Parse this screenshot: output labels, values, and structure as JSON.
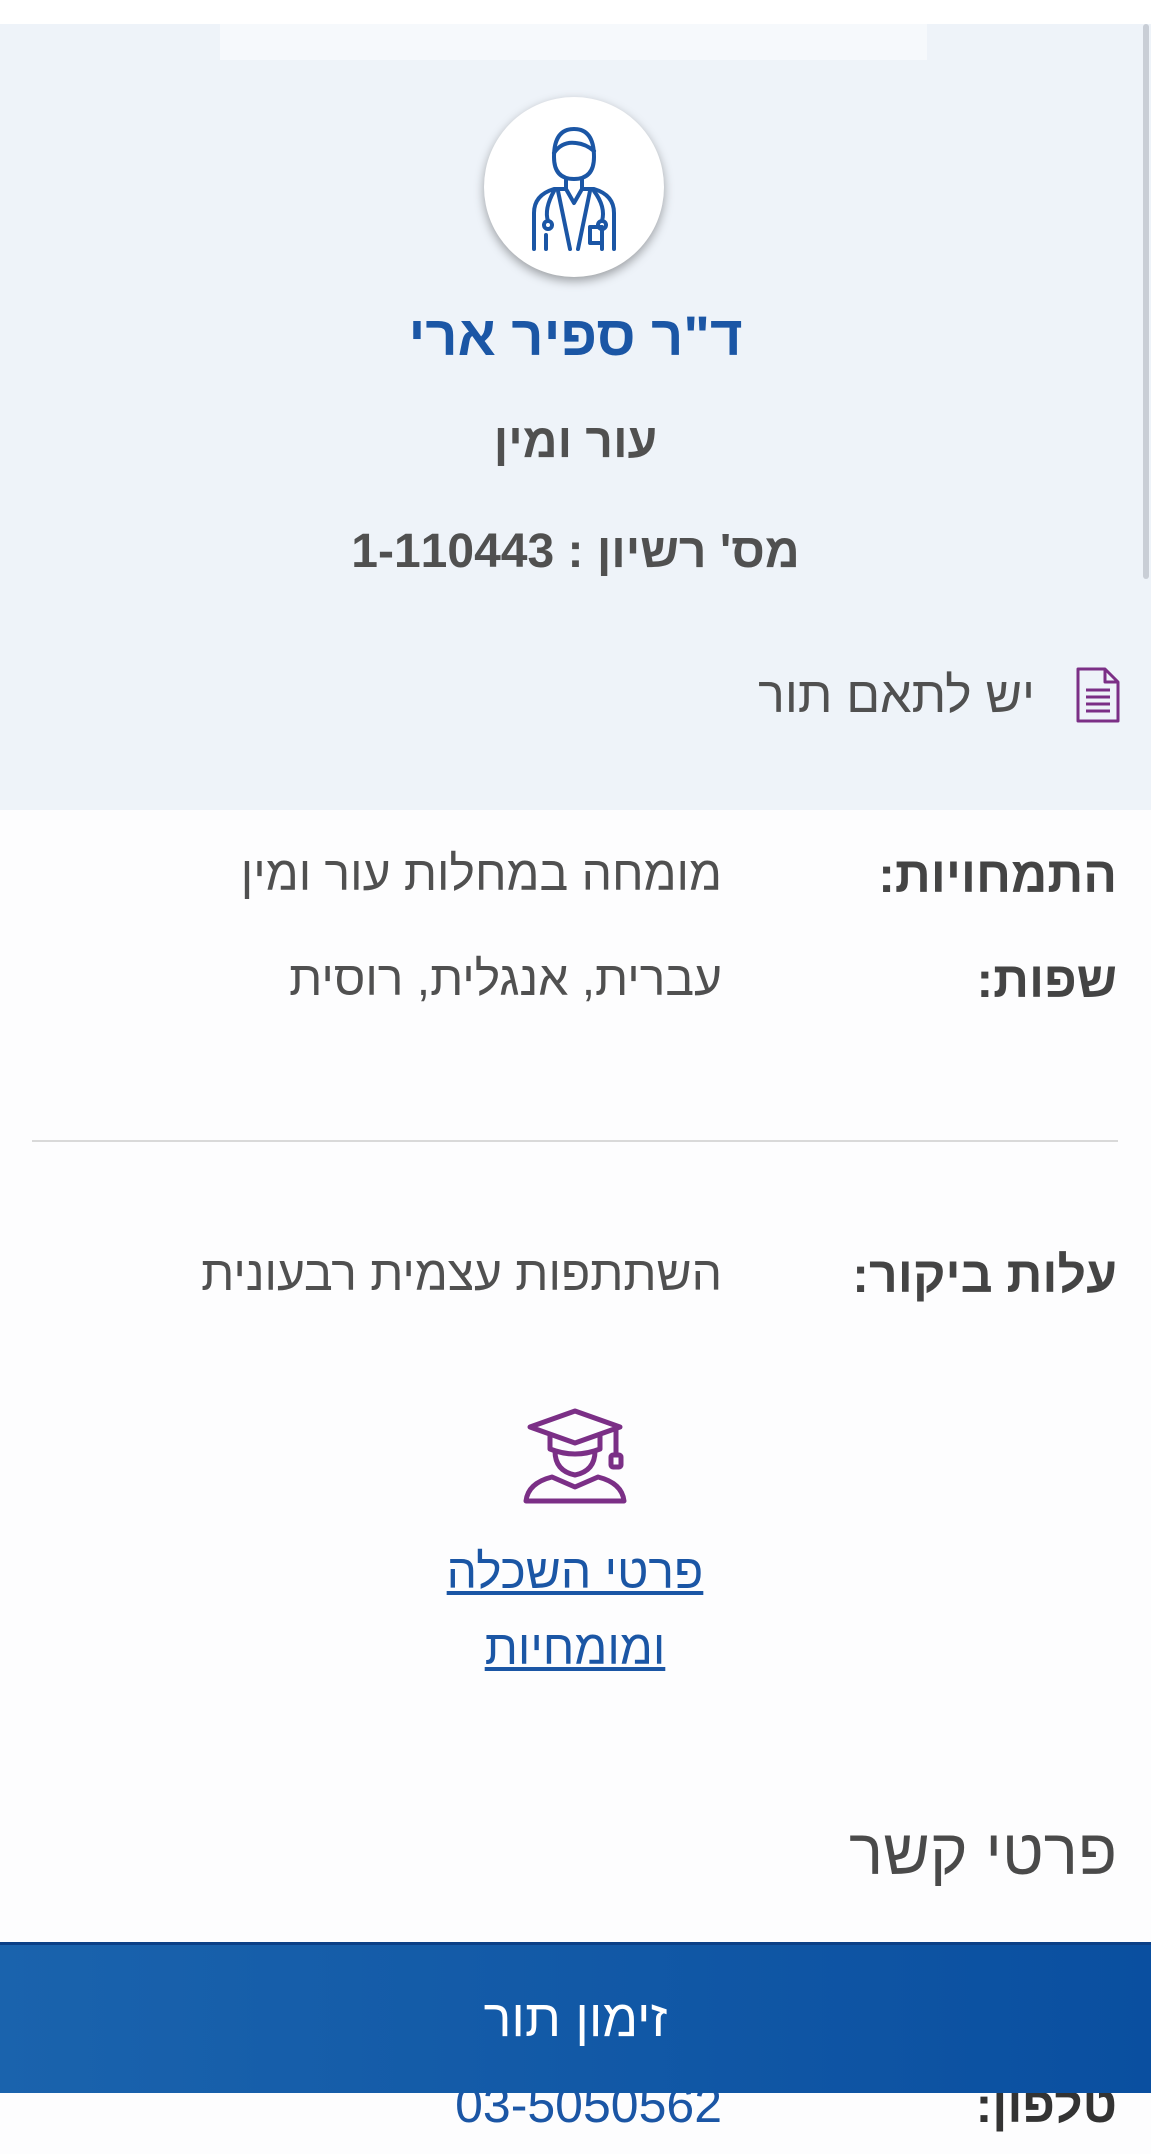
{
  "doctor": {
    "name": "ד\"ר ספיר ארי",
    "specialty": "עור ומין",
    "license_label": "מס' רשיון :",
    "license_number": "1-110443",
    "coordination_text": "יש לתאם תור",
    "avatar_icon": "doctor-icon",
    "coordination_icon": "document-icon"
  },
  "details": {
    "expertise_label": "התמחויות:",
    "expertise_value": "מומחה במחלות עור ומין",
    "languages_label": "שפות:",
    "languages_value": "עברית, אנגלית, רוסית",
    "cost_label": "עלות ביקור:",
    "cost_value": "השתתפות עצמית רבעונית"
  },
  "education": {
    "icon": "graduation-cap-icon",
    "link_line1": "פרטי השכלה",
    "link_line2": "ומומחיות"
  },
  "contact": {
    "title": "פרטי קשר",
    "phone_label": "טלפון:",
    "phone_value": "03-5050562"
  },
  "actions": {
    "book_label": "זימון תור"
  },
  "colors": {
    "brand_blue": "#1b56a5",
    "button_blue": "#0a4fa0",
    "header_bg": "#eef3f9",
    "icon_purple": "#7b2f86"
  }
}
